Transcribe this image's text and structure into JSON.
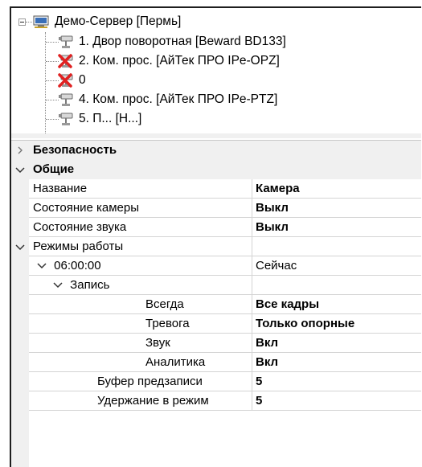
{
  "tree": {
    "root": {
      "label": "Демо-Сервер [Пермь]",
      "icon": "server-icon"
    },
    "items": [
      {
        "label": "1. Двор поворотная [Beward BD133]",
        "icon": "camera-icon",
        "disabled": false
      },
      {
        "label": "2. Ком. прос. [АйТек ПРО IPe-OPZ]",
        "icon": "camera-disabled-icon",
        "disabled": true
      },
      {
        "label": "0",
        "icon": "camera-disabled-icon",
        "disabled": true
      },
      {
        "label": "4. Ком. прос. [АйТек ПРО IPe-PTZ]",
        "icon": "camera-icon",
        "disabled": false
      },
      {
        "label": "5. П... [Н...]",
        "icon": "camera-icon",
        "disabled": false
      }
    ]
  },
  "grid": {
    "categories": {
      "security": {
        "label": "Безопасность",
        "state": "collapsed"
      },
      "general": {
        "label": "Общие",
        "state": "expanded"
      }
    },
    "rows": {
      "name": {
        "name": "Название",
        "value": "Камера"
      },
      "camera_state": {
        "name": "Состояние камеры",
        "value": "Выкл"
      },
      "sound_state": {
        "name": "Состояние звука",
        "value": "Выкл"
      },
      "work_modes": {
        "name": "Режимы работы",
        "value": ""
      },
      "time": {
        "name": "06:00:00",
        "value": "Сейчас"
      },
      "record": {
        "name": "Запись",
        "value": ""
      },
      "always": {
        "name": "Всегда",
        "value": "Все кадры"
      },
      "alarm": {
        "name": "Тревога",
        "value": "Только опорные"
      },
      "sound": {
        "name": "Звук",
        "value": "Вкл"
      },
      "analytics": {
        "name": "Аналитика",
        "value": "Вкл"
      },
      "prebuffer": {
        "name": "Буфер предзаписи",
        "value": "5"
      },
      "hold": {
        "name": "Удержание в режим",
        "value": "5"
      }
    }
  },
  "colors": {
    "gutter": "#f0f0f0",
    "grid_line": "#d4d4d4",
    "disabled_x": "#e02020"
  }
}
